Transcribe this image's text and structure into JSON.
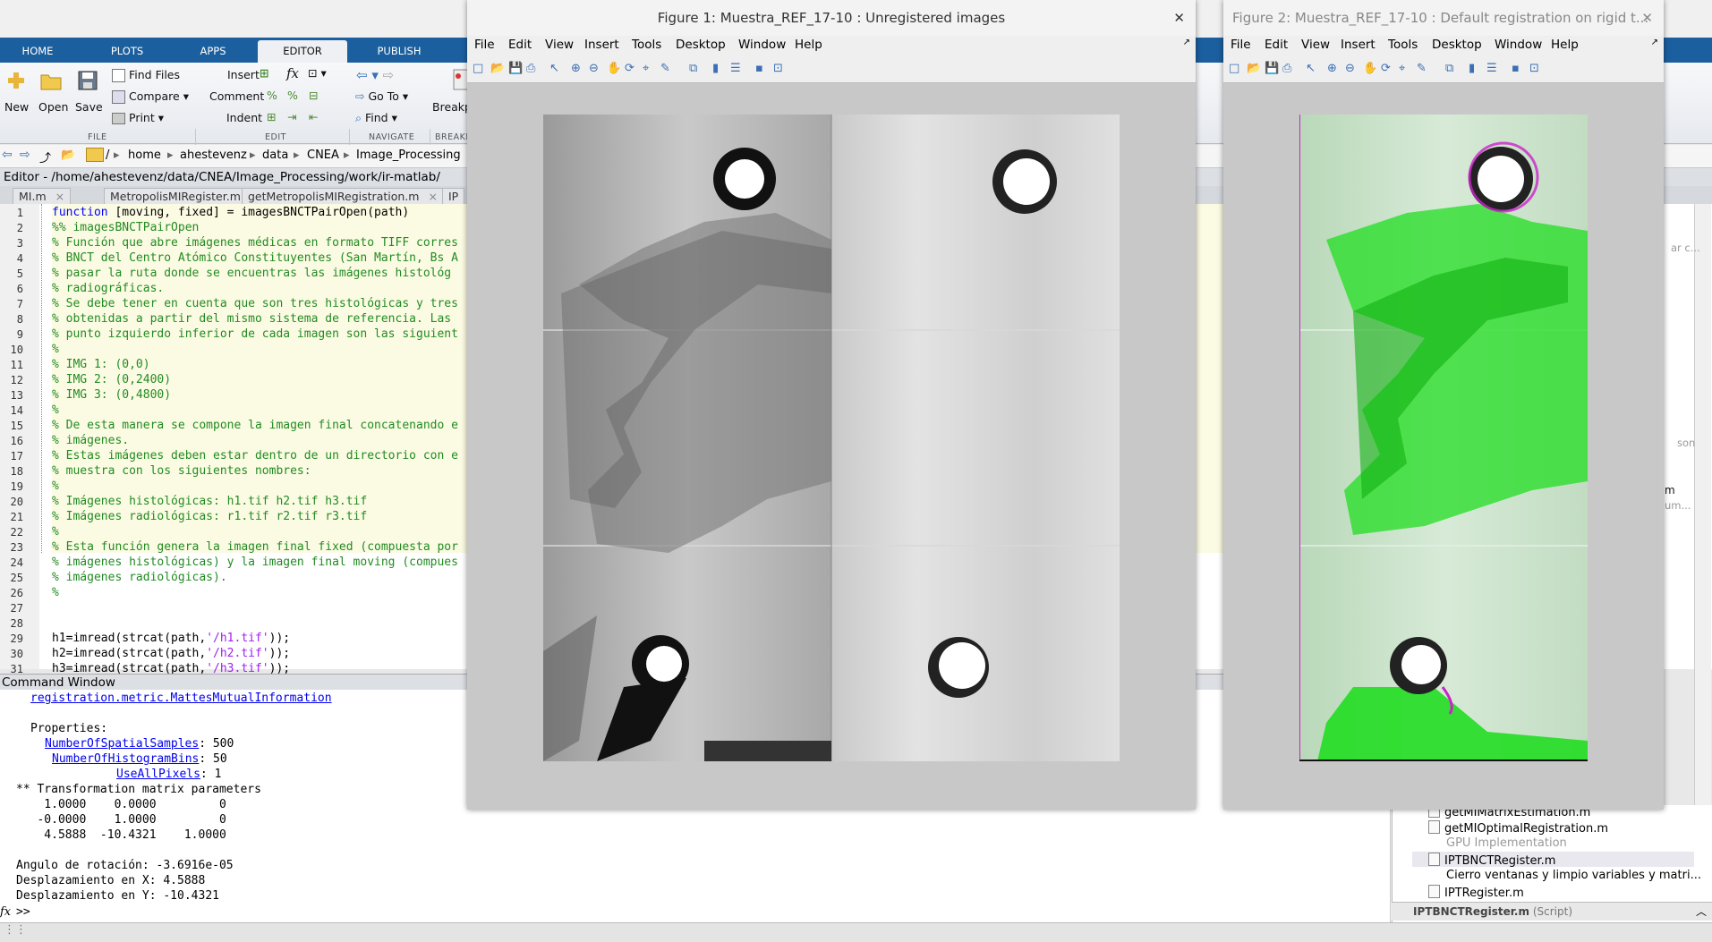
{
  "ribbon": {
    "tabs": [
      "HOME",
      "PLOTS",
      "APPS",
      "EDITOR",
      "PUBLISH"
    ],
    "active_tab": "EDITOR",
    "file": {
      "new": "New",
      "open": "Open",
      "save": "Save",
      "find_files": "Find Files",
      "compare": "Compare",
      "print": "Print",
      "group": "FILE"
    },
    "edit": {
      "insert": "Insert",
      "comment": "Comment",
      "indent": "Indent",
      "group": "EDIT"
    },
    "navigate": {
      "go_to": "Go To",
      "find": "Find",
      "group": "NAVIGATE"
    },
    "breakpoints": {
      "label": "Breakp",
      "group": "BREAKP"
    }
  },
  "address": {
    "crumbs": [
      "/",
      "home",
      "ahestevenz",
      "data",
      "CNEA",
      "Image_Processing"
    ]
  },
  "editor": {
    "title": "Editor - /home/ahestevenz/data/CNEA/Image_Processing/work/ir-matlab/",
    "tabs": [
      "MI.m",
      "MetropolisMIRegister.m",
      "getMetropolisMIRegistration.m",
      "IP"
    ],
    "lines": [
      {
        "n": "1",
        "segs": [
          {
            "t": "function",
            "c": "kw"
          },
          {
            "t": " [moving, fixed] = imagesBNCTPairOpen(path)",
            "c": ""
          }
        ]
      },
      {
        "n": "2",
        "segs": [
          {
            "t": "%% imagesBNCTPairOpen",
            "c": "cm"
          }
        ]
      },
      {
        "n": "3",
        "segs": [
          {
            "t": "% Función que abre imágenes médicas en formato TIFF corres",
            "c": "cm"
          }
        ]
      },
      {
        "n": "4",
        "segs": [
          {
            "t": "% BNCT del Centro Atómico Constituyentes (San Martín, Bs A",
            "c": "cm"
          }
        ]
      },
      {
        "n": "5",
        "segs": [
          {
            "t": "% pasar la ruta donde se encuentras las imágenes histológ",
            "c": "cm"
          }
        ]
      },
      {
        "n": "6",
        "segs": [
          {
            "t": "% radiográficas.",
            "c": "cm"
          }
        ]
      },
      {
        "n": "7",
        "segs": [
          {
            "t": "% Se debe tener en cuenta que son tres histológicas y tres",
            "c": "cm"
          }
        ]
      },
      {
        "n": "8",
        "segs": [
          {
            "t": "% obtenidas a partir del mismo sistema de referencia. Las",
            "c": "cm"
          }
        ]
      },
      {
        "n": "9",
        "segs": [
          {
            "t": "% punto izquierdo inferior de cada imagen son las siguient",
            "c": "cm"
          }
        ]
      },
      {
        "n": "10",
        "segs": [
          {
            "t": "%",
            "c": "cm"
          }
        ]
      },
      {
        "n": "11",
        "segs": [
          {
            "t": "% IMG 1: (0,0)",
            "c": "cm"
          }
        ]
      },
      {
        "n": "12",
        "segs": [
          {
            "t": "% IMG 2: (0,2400)",
            "c": "cm"
          }
        ]
      },
      {
        "n": "13",
        "segs": [
          {
            "t": "% IMG 3: (0,4800)",
            "c": "cm"
          }
        ]
      },
      {
        "n": "14",
        "segs": [
          {
            "t": "%",
            "c": "cm"
          }
        ]
      },
      {
        "n": "15",
        "segs": [
          {
            "t": "% De esta manera se compone la imagen final concatenando e",
            "c": "cm"
          }
        ]
      },
      {
        "n": "16",
        "segs": [
          {
            "t": "% imágenes.",
            "c": "cm"
          }
        ]
      },
      {
        "n": "17",
        "segs": [
          {
            "t": "% Estas imágenes deben estar dentro de un directorio con e",
            "c": "cm"
          }
        ]
      },
      {
        "n": "18",
        "segs": [
          {
            "t": "% muestra con los siguientes nombres:",
            "c": "cm"
          }
        ]
      },
      {
        "n": "19",
        "segs": [
          {
            "t": "%",
            "c": "cm"
          }
        ]
      },
      {
        "n": "20",
        "segs": [
          {
            "t": "% Imágenes histológicas: h1.tif h2.tif h3.tif",
            "c": "cm"
          }
        ]
      },
      {
        "n": "21",
        "segs": [
          {
            "t": "% Imágenes radiológicas: r1.tif r2.tif r3.tif",
            "c": "cm"
          }
        ]
      },
      {
        "n": "22",
        "segs": [
          {
            "t": "%",
            "c": "cm"
          }
        ]
      },
      {
        "n": "23",
        "segs": [
          {
            "t": "% Esta función genera la imagen final fixed (compuesta por",
            "c": "cm"
          }
        ]
      },
      {
        "n": "24",
        "segs": [
          {
            "t": "% imágenes histológicas) y la imagen final moving (compues",
            "c": "cm"
          }
        ]
      },
      {
        "n": "25",
        "segs": [
          {
            "t": "% imágenes radiológicas).",
            "c": "cm"
          }
        ]
      },
      {
        "n": "26",
        "segs": [
          {
            "t": "%",
            "c": "cm"
          }
        ]
      },
      {
        "n": "27",
        "segs": []
      },
      {
        "n": "28",
        "segs": []
      },
      {
        "n": "29",
        "segs": [
          {
            "t": "h1=imread(strcat(path,",
            "c": ""
          },
          {
            "t": "'/h1.tif'",
            "c": "st"
          },
          {
            "t": "));",
            "c": ""
          }
        ]
      },
      {
        "n": "30",
        "segs": [
          {
            "t": "h2=imread(strcat(path,",
            "c": ""
          },
          {
            "t": "'/h2.tif'",
            "c": "st"
          },
          {
            "t": "));",
            "c": ""
          }
        ]
      },
      {
        "n": "31",
        "segs": [
          {
            "t": "h3=imread(strcat(path,",
            "c": ""
          },
          {
            "t": "'/h3.tif'",
            "c": "st"
          },
          {
            "t": "));",
            "c": ""
          }
        ]
      }
    ]
  },
  "command_window": {
    "title": "Command Window",
    "metric_link": "registration.metric.MattesMutualInformation",
    "properties_label": "Properties:",
    "props": [
      {
        "name": "NumberOfSpatialSamples",
        "value": ": 500"
      },
      {
        "name": "NumberOfHistogramBins",
        "value": ": 50"
      },
      {
        "name": "UseAllPixels",
        "value": ": 1"
      }
    ],
    "matrix_title": "** Transformation matrix parameters",
    "matrix_rows": [
      "    1.0000    0.0000         0",
      "   -0.0000    1.0000         0",
      "    4.5888  -10.4321    1.0000"
    ],
    "angle": "Angulo de rotación: -3.6916e-05",
    "dx": "Desplazamiento en X: 4.5888",
    "dy": "Desplazamiento en Y: -10.4321",
    "prompt": ">>"
  },
  "current_folder": {
    "items": [
      {
        "label": "getMIMatrixEstimation.m",
        "type": "file"
      },
      {
        "label": "getMIOptimalRegistration.m",
        "type": "file"
      },
      {
        "label": "GPU Implementation",
        "type": "note"
      },
      {
        "label": "IPTBNCTRegister.m",
        "type": "file",
        "selected": true
      },
      {
        "label": "Cierro ventanas y limpio variables y matri...",
        "type": "desc"
      },
      {
        "label": "IPTRegister.m",
        "type": "file"
      }
    ],
    "footer": "IPTBNCTRegister.m",
    "footer_suffix": "(Script)",
    "side_snippets": [
      "ar c...",
      "son",
      "m",
      "um..."
    ]
  },
  "figure1": {
    "title": "Figure 1: Muestra_REF_17-10 : Unregistered images",
    "menus": [
      "File",
      "Edit",
      "View",
      "Insert",
      "Tools",
      "Desktop",
      "Window",
      "Help"
    ]
  },
  "figure2": {
    "title": "Figure 2: Muestra_REF_17-10 : Default registration on rigid t...",
    "menus": [
      "File",
      "Edit",
      "View",
      "Insert",
      "Tools",
      "Desktop",
      "Window",
      "Help"
    ]
  },
  "colors": {
    "ribbon_blue": "#1b5f9e",
    "overlay_green": "#22dd22",
    "overlay_magenta": "#cc22cc"
  }
}
